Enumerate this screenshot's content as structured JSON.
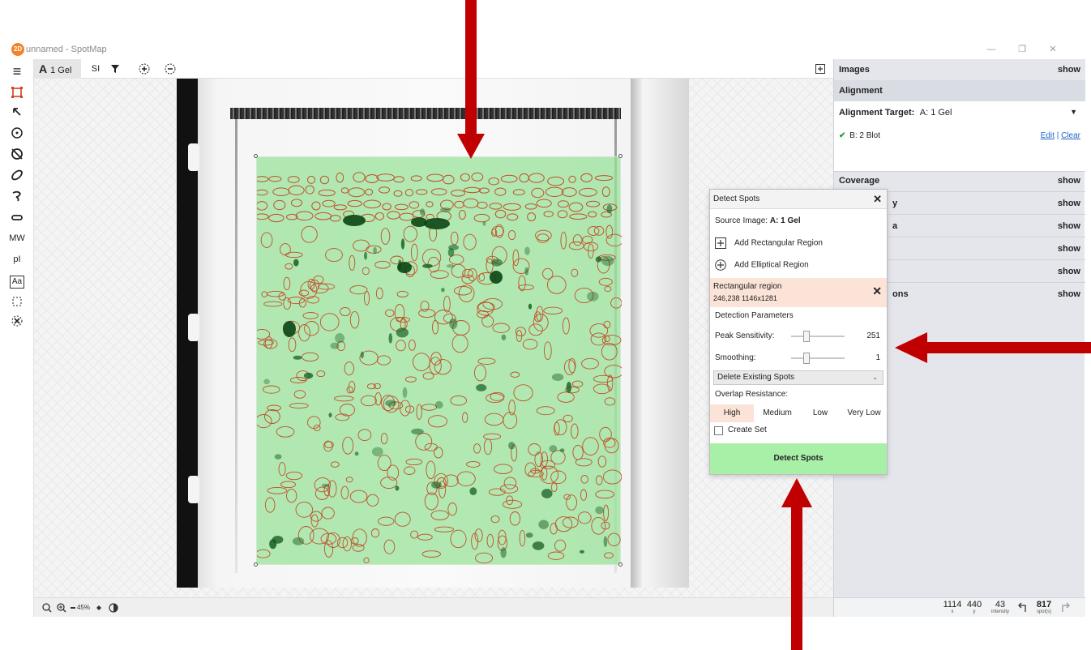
{
  "window": {
    "logo": "2D",
    "title": "unnamed - SpotMap",
    "minimize": "—",
    "maximize": "❐",
    "close": "✕"
  },
  "left_tools": {
    "menu": "≡",
    "mw_label": "MW",
    "pi_label": "pI",
    "text_tool_label": "Aa"
  },
  "top_tools": {
    "gel_tab_letter": "A",
    "gel_tab_name": "1 Gel",
    "si_label": "SI"
  },
  "canvas": {
    "zoom_level": "45%"
  },
  "right_panel": {
    "sections": {
      "images": "Images",
      "alignment": "Alignment",
      "coverage": "Coverage",
      "row4": "y",
      "row5": "a",
      "row8": "ons"
    },
    "show_label": "show",
    "alignment_target_label": "Alignment Target:",
    "alignment_target_value": "A: 1 Gel",
    "aligned_image": "B: 2 Blot",
    "edit_label": "Edit",
    "separator": "|",
    "clear_label": "Clear",
    "coords": {
      "x_value": "1114",
      "x_label": "x",
      "y_value": "440",
      "y_label": "y",
      "intensity_value": "43",
      "intensity_label": "intensity",
      "spots_value": "817",
      "spots_label": "spot(s)"
    }
  },
  "detect_spots": {
    "title": "Detect Spots",
    "source_label": "Source Image:",
    "source_value": "A: 1 Gel",
    "add_rect": "Add Rectangular Region",
    "add_ellipse": "Add Elliptical Region",
    "region_name": "Rectangular region",
    "region_dims": "246,238  1146x1281",
    "params_label": "Detection Parameters",
    "peak_label": "Peak Sensitivity:",
    "peak_value": "251",
    "peak_level": 0.25,
    "smooth_label": "Smoothing:",
    "smooth_value": "1",
    "smooth_level": 0.25,
    "mode_option": "Delete Existing Spots",
    "overlap_label": "Overlap Resistance:",
    "overlap_options": [
      "High",
      "Medium",
      "Low",
      "Very Low"
    ],
    "overlap_selected": "High",
    "create_set": "Create Set",
    "detect_button": "Detect Spots"
  },
  "colors": {
    "annotation_arrow": "#c00000",
    "region_fill": "#96e296",
    "spot_outline": "#c0502a",
    "detect_button": "#a8f0a8",
    "selected_segment": "#fbe3d8"
  }
}
